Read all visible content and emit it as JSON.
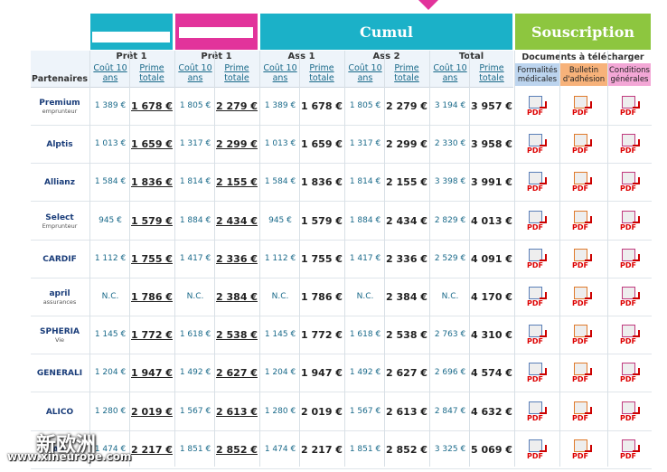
{
  "headers": {
    "cumul": "Cumul",
    "souscription": "Souscription"
  },
  "groups": {
    "pret1a": "Prêt 1",
    "pret1b": "Prêt 1",
    "ass1": "Ass 1",
    "ass2": "Ass 2",
    "total": "Total"
  },
  "cols": {
    "cout": "Coût 10 ans",
    "prime": "Prime totale",
    "partenaires": "Partenaires"
  },
  "docs": {
    "title": "Documents à télécharger",
    "formalites": "Formalités médicales",
    "bulletin": "Bulletin d'adhésion",
    "conditions": "Conditions générales",
    "pdf": "PDF"
  },
  "rows": [
    {
      "partner": "Premium",
      "partner_sub": "emprunteur",
      "c1": "1 389 €",
      "p1": "1 678 €",
      "c2": "1 805 €",
      "p2": "2 279 €",
      "c3": "1 389 €",
      "p3": "1 678 €",
      "c4": "1 805 €",
      "p4": "2 279 €",
      "c5": "3 194 €",
      "p5": "3 957 €"
    },
    {
      "partner": "Alptis",
      "partner_sub": "",
      "c1": "1 013 €",
      "p1": "1 659 €",
      "c2": "1 317 €",
      "p2": "2 299 €",
      "c3": "1 013 €",
      "p3": "1 659 €",
      "c4": "1 317 €",
      "p4": "2 299 €",
      "c5": "2 330 €",
      "p5": "3 958 €"
    },
    {
      "partner": "Allianz",
      "partner_sub": "",
      "c1": "1 584 €",
      "p1": "1 836 €",
      "c2": "1 814 €",
      "p2": "2 155 €",
      "c3": "1 584 €",
      "p3": "1 836 €",
      "c4": "1 814 €",
      "p4": "2 155 €",
      "c5": "3 398 €",
      "p5": "3 991 €"
    },
    {
      "partner": "Select",
      "partner_sub": "Emprunteur",
      "c1": "945 €",
      "p1": "1 579 €",
      "c2": "1 884 €",
      "p2": "2 434 €",
      "c3": "945 €",
      "p3": "1 579 €",
      "c4": "1 884 €",
      "p4": "2 434 €",
      "c5": "2 829 €",
      "p5": "4 013 €"
    },
    {
      "partner": "CARDIF",
      "partner_sub": "",
      "c1": "1 112 €",
      "p1": "1 755 €",
      "c2": "1 417 €",
      "p2": "2 336 €",
      "c3": "1 112 €",
      "p3": "1 755 €",
      "c4": "1 417 €",
      "p4": "2 336 €",
      "c5": "2 529 €",
      "p5": "4 091 €"
    },
    {
      "partner": "april",
      "partner_sub": "assurances",
      "c1": "N.C.",
      "p1": "1 786 €",
      "c2": "N.C.",
      "p2": "2 384 €",
      "c3": "N.C.",
      "p3": "1 786 €",
      "c4": "N.C.",
      "p4": "2 384 €",
      "c5": "N.C.",
      "p5": "4 170 €"
    },
    {
      "partner": "SPHERIA",
      "partner_sub": "Vie",
      "c1": "1 145 €",
      "p1": "1 772 €",
      "c2": "1 618 €",
      "p2": "2 538 €",
      "c3": "1 145 €",
      "p3": "1 772 €",
      "c4": "1 618 €",
      "p4": "2 538 €",
      "c5": "2 763 €",
      "p5": "4 310 €"
    },
    {
      "partner": "GENERALI",
      "partner_sub": "",
      "c1": "1 204 €",
      "p1": "1 947 €",
      "c2": "1 492 €",
      "p2": "2 627 €",
      "c3": "1 204 €",
      "p3": "1 947 €",
      "c4": "1 492 €",
      "p4": "2 627 €",
      "c5": "2 696 €",
      "p5": "4 574 €"
    },
    {
      "partner": "ALICO",
      "partner_sub": "",
      "c1": "1 280 €",
      "p1": "2 019 €",
      "c2": "1 567 €",
      "p2": "2 613 €",
      "c3": "1 280 €",
      "p3": "2 019 €",
      "c4": "1 567 €",
      "p4": "2 613 €",
      "c5": "2 847 €",
      "p5": "4 632 €"
    },
    {
      "partner": "AIL",
      "partner_sub": "",
      "c1": "1 474 €",
      "p1": "2 217 €",
      "c2": "1 851 €",
      "p2": "2 852 €",
      "c3": "1 474 €",
      "p3": "2 217 €",
      "c4": "1 851 €",
      "p4": "2 852 €",
      "c5": "3 325 €",
      "p5": "5 069 €"
    }
  ],
  "watermark": {
    "line1": "新欧洲",
    "line2": "www.xineurope.com"
  }
}
